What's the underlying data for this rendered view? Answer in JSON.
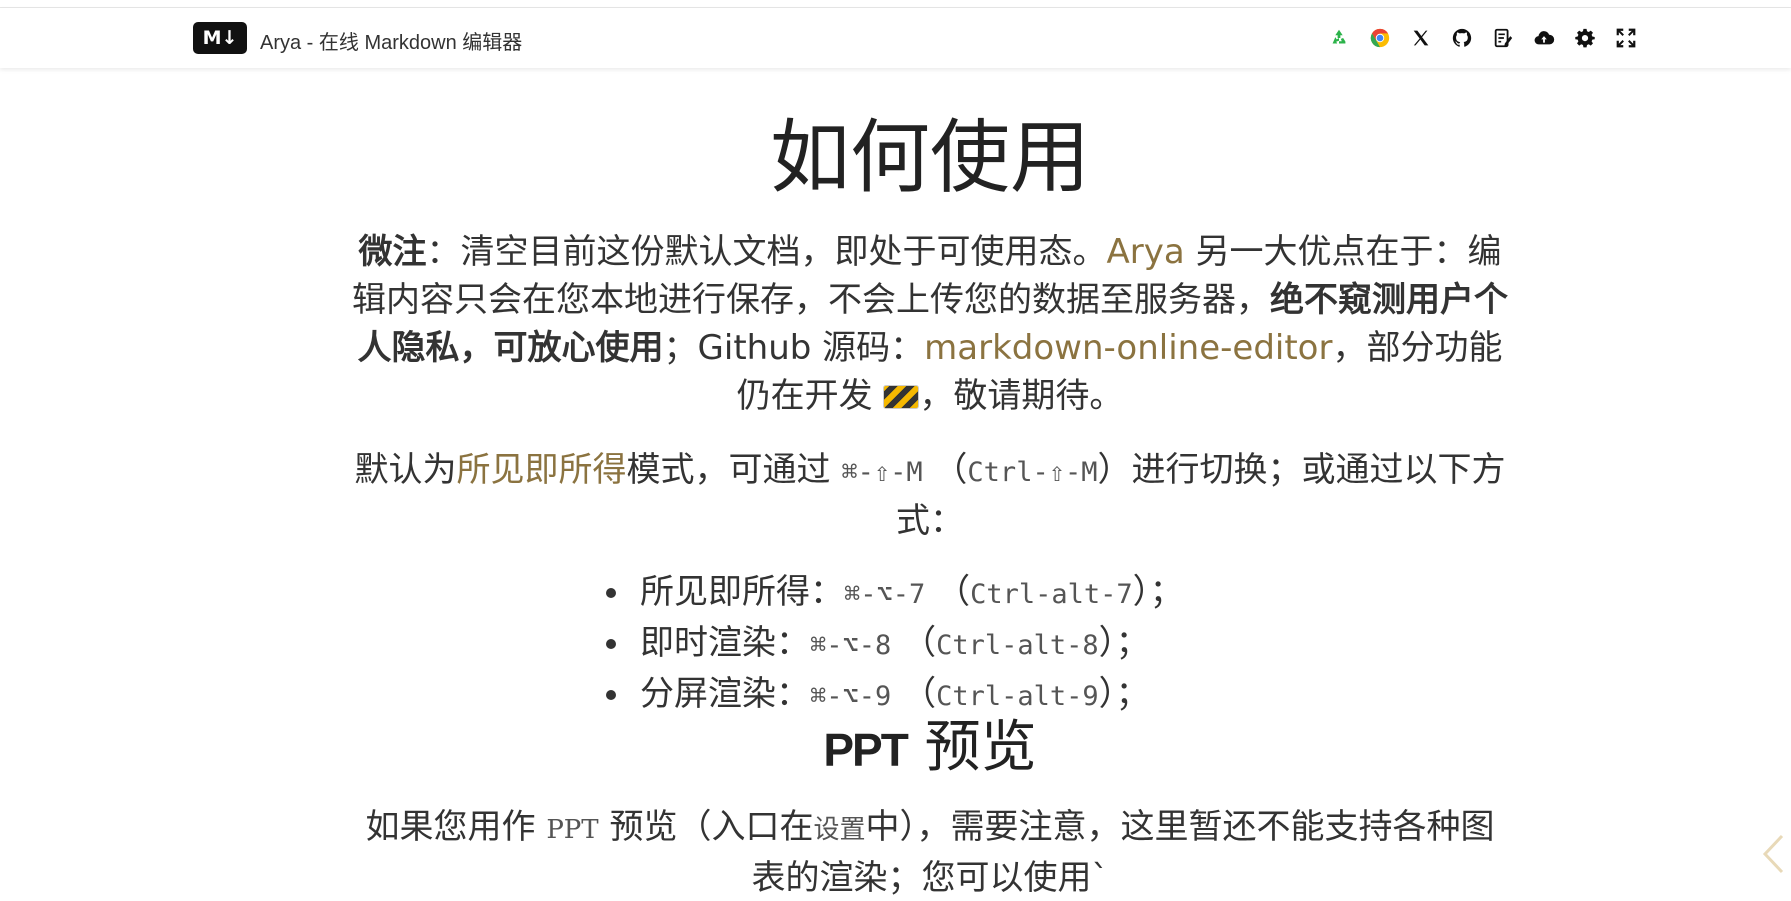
{
  "header": {
    "logo_text": "M↓",
    "title": "Arya - 在线 Markdown 编辑器",
    "toolbar": [
      {
        "name": "recycle-icon",
        "color": "#2cb34a"
      },
      {
        "name": "chrome-icon",
        "color": "#ea4335"
      },
      {
        "name": "x-twitter-icon",
        "color": "#111111"
      },
      {
        "name": "github-icon",
        "color": "#111111"
      },
      {
        "name": "edit-note-icon",
        "color": "#111111"
      },
      {
        "name": "cloud-upload-icon",
        "color": "#111111"
      },
      {
        "name": "gear-icon",
        "color": "#111111"
      },
      {
        "name": "fullscreen-icon",
        "color": "#111111"
      }
    ]
  },
  "doc": {
    "title": "如何使用",
    "p1": {
      "bold_prefix": "微注",
      "text1": "：清空目前这份默认文档，即处于可使用态。",
      "link_arya": "Arya",
      "text2": " 另一大优点在于：编辑内容只会在您本地进行保存，不会上传您的数据至服务器，",
      "bold_privacy": "绝不窥测用户个人隐私，可放心使用",
      "text3": "；Github 源码：",
      "link_repo": "markdown-online-editor",
      "text4": "，部分功能仍在开发 ",
      "text5": "，敬请期待。"
    },
    "p2": {
      "text1": "默认为",
      "link_wysiwyg": "所见即所得",
      "text2": "模式，可通过 ",
      "mac_key": "⌘-⇧-M",
      "text3": " （",
      "win_key": "Ctrl-⇧-M",
      "text4": "）进行切换；或通过以下方式："
    },
    "shortcuts": [
      {
        "label": "所见即所得：",
        "mac": "⌘-⌥-7",
        "win": "Ctrl-alt-7"
      },
      {
        "label": "即时渲染：",
        "mac": "⌘-⌥-8",
        "win": "Ctrl-alt-8"
      },
      {
        "label": "分屏渲染：",
        "mac": "⌘-⌥-9",
        "win": "Ctrl-alt-9"
      }
    ],
    "shortcut_open": " （",
    "shortcut_close": "）；",
    "ppt": {
      "title_tag": "PPT",
      "title_text": " 预览",
      "text1": "如果您用作 ",
      "ppt_word": "PPT",
      "text2": " 预览（入口在",
      "settings_word": "设置",
      "text3": "中），需要注意，这里暂还不能支持各种图表的渲染；您可以使用`"
    }
  },
  "colors": {
    "link": "#8b7340",
    "text": "#333333"
  }
}
